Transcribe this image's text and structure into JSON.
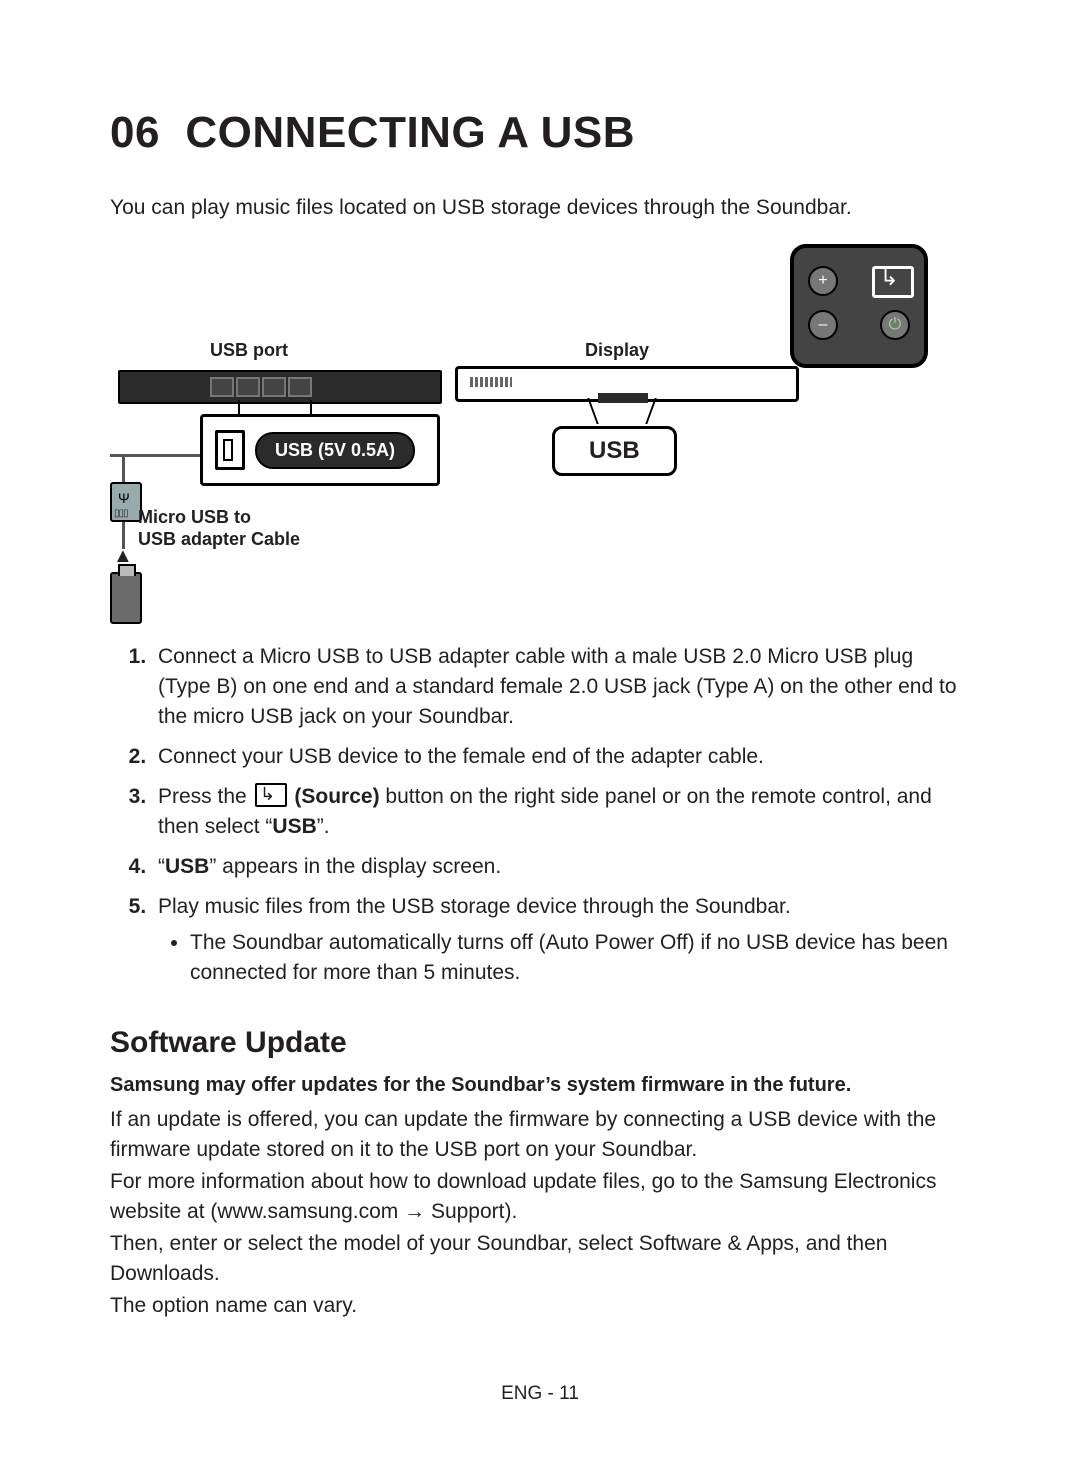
{
  "section_number": "06",
  "section_title": "CONNECTING A USB",
  "intro": "You can play music files located on USB storage devices through the Soundbar.",
  "diagram": {
    "usb_port_label": "USB port",
    "usb_5v_label": "USB (5V 0.5A)",
    "cable_label_line1": "Micro USB to",
    "cable_label_line2": "USB adapter Cable",
    "display_label": "Display",
    "usb_display_text": "USB",
    "remote": {
      "plus": "+",
      "minus": "–",
      "power_icon": "⏻",
      "source_icon": "source-icon"
    }
  },
  "steps": {
    "s1": "Connect a Micro USB to USB adapter cable with a male USB 2.0 Micro USB plug (Type B) on one end and a standard female 2.0 USB jack (Type A) on the other end to the micro USB jack on your Soundbar.",
    "s2": "Connect your USB device to the female end of the adapter cable.",
    "s3_pre": "Press the ",
    "s3_source_bold": "(Source)",
    "s3_post": " button on the right side panel or on the remote control, and then select “",
    "s3_usb": "USB",
    "s3_end": "”.",
    "s4_pre": "“",
    "s4_usb": "USB",
    "s4_post": "” appears in the display screen.",
    "s5": "Play music files from the USB storage device through the Soundbar.",
    "s5_bullet": "The Soundbar automatically turns off (Auto Power Off) if no USB device has been connected for more than 5 minutes."
  },
  "software_update": {
    "heading": "Software Update",
    "lead": "Samsung may offer updates for the Soundbar’s system firmware in the future.",
    "p1": "If an update is offered, you can update the firmware by connecting a USB device with the firmware update stored on it to the USB port on your Soundbar.",
    "p2_pre": "For more information about how to download update files, go to the Samsung Electronics website at (www.samsung.com ",
    "p2_arrow": "→",
    "p2_post": " Support).",
    "p3": "Then, enter or select the model of your Soundbar, select Software & Apps, and then Downloads.",
    "p4": "The option name can vary."
  },
  "footer": "ENG - 11"
}
